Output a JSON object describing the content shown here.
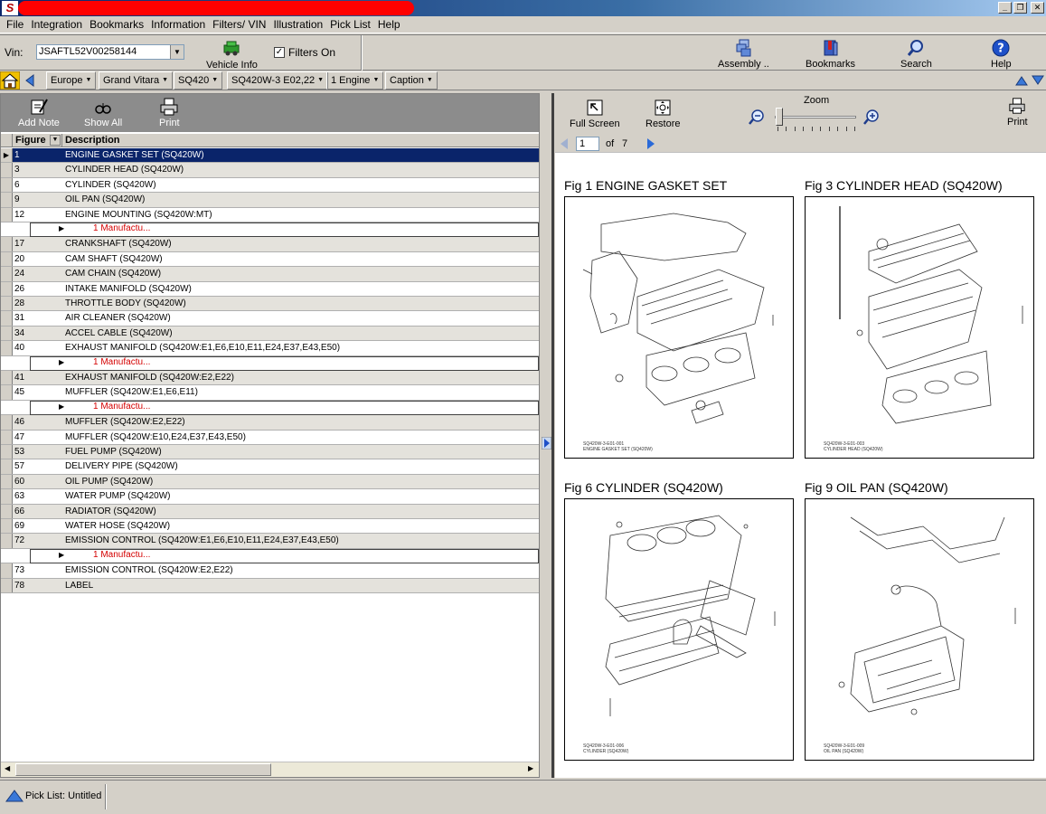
{
  "menu": [
    "File",
    "Integration",
    "Bookmarks",
    "Information",
    "Filters/ VIN",
    "Illustration",
    "Pick List",
    "Help"
  ],
  "toolbar": {
    "vin_label": "Vin:",
    "vin_value": "JSAFTL52V00258144",
    "vehicle_info": "Vehicle Info",
    "filters_label": "Filters On",
    "filters_checked": true,
    "assembly": "Assembly ..",
    "bookmarks": "Bookmarks",
    "search": "Search",
    "help": "Help"
  },
  "breadcrumbs": [
    "Europe",
    "Grand Vitara",
    "SQ420",
    "SQ420W-3 E02,22",
    "1 Engine",
    "Caption"
  ],
  "left_toolbar": {
    "add_note": "Add Note",
    "show_all": "Show All",
    "print": "Print"
  },
  "grid": {
    "col_figure": "Figure",
    "col_description": "Description",
    "rows": [
      {
        "figure": "1",
        "description": "ENGINE GASKET SET (SQ420W)",
        "selected": true
      },
      {
        "figure": "3",
        "description": "CYLINDER HEAD (SQ420W)"
      },
      {
        "figure": "6",
        "description": "CYLINDER (SQ420W)"
      },
      {
        "figure": "9",
        "description": "OIL PAN (SQ420W)"
      },
      {
        "figure": "12",
        "description": "ENGINE MOUNTING (SQ420W:MT)"
      },
      {
        "sub": "1 Manufactu..."
      },
      {
        "figure": "17",
        "description": "CRANKSHAFT (SQ420W)"
      },
      {
        "figure": "20",
        "description": "CAM SHAFT (SQ420W)"
      },
      {
        "figure": "24",
        "description": "CAM CHAIN (SQ420W)"
      },
      {
        "figure": "26",
        "description": "INTAKE MANIFOLD (SQ420W)"
      },
      {
        "figure": "28",
        "description": "THROTTLE BODY (SQ420W)"
      },
      {
        "figure": "31",
        "description": "AIR CLEANER (SQ420W)"
      },
      {
        "figure": "34",
        "description": "ACCEL CABLE (SQ420W)"
      },
      {
        "figure": "40",
        "description": "EXHAUST MANIFOLD (SQ420W:E1,E6,E10,E11,E24,E37,E43,E50)"
      },
      {
        "sub": "1 Manufactu..."
      },
      {
        "figure": "41",
        "description": "EXHAUST MANIFOLD (SQ420W:E2,E22)"
      },
      {
        "figure": "45",
        "description": "MUFFLER (SQ420W:E1,E6,E11)"
      },
      {
        "sub": "1 Manufactu..."
      },
      {
        "figure": "46",
        "description": "MUFFLER (SQ420W:E2,E22)"
      },
      {
        "figure": "47",
        "description": "MUFFLER (SQ420W:E10,E24,E37,E43,E50)"
      },
      {
        "figure": "53",
        "description": "FUEL PUMP (SQ420W)"
      },
      {
        "figure": "57",
        "description": "DELIVERY PIPE (SQ420W)"
      },
      {
        "figure": "60",
        "description": "OIL PUMP (SQ420W)"
      },
      {
        "figure": "63",
        "description": "WATER PUMP (SQ420W)"
      },
      {
        "figure": "66",
        "description": "RADIATOR (SQ420W)"
      },
      {
        "figure": "69",
        "description": "WATER HOSE (SQ420W)"
      },
      {
        "figure": "72",
        "description": "EMISSION CONTROL (SQ420W:E1,E6,E10,E11,E24,E37,E43,E50)"
      },
      {
        "sub": "1 Manufactu..."
      },
      {
        "figure": "73",
        "description": "EMISSION CONTROL (SQ420W:E2,E22)"
      },
      {
        "figure": "78",
        "description": "LABEL"
      }
    ]
  },
  "right_toolbar": {
    "full_screen": "Full Screen",
    "restore": "Restore",
    "zoom": "Zoom",
    "print": "Print"
  },
  "pager": {
    "current": "1",
    "of": "of",
    "total": "7"
  },
  "figures": [
    {
      "title": "Fig 1  ENGINE GASKET SET",
      "caption1": "SQ420W-3-E01-001",
      "caption2": "ENGINE GASKET SET (SQ420W)"
    },
    {
      "title": "Fig 3  CYLINDER HEAD (SQ420W)",
      "caption1": "SQ420W-3-E01-003",
      "caption2": "CYLINDER HEAD (SQ420W)"
    },
    {
      "title": "Fig 6  CYLINDER (SQ420W)",
      "caption1": "SQ420W-3-E01-006",
      "caption2": "CYLINDER (SQ420W)"
    },
    {
      "title": "Fig 9  OIL PAN (SQ420W)",
      "caption1": "SQ420W-3-E01-009",
      "caption2": "OIL PAN (SQ420W)"
    }
  ],
  "status": {
    "pick_list": "Pick List: Untitled"
  }
}
